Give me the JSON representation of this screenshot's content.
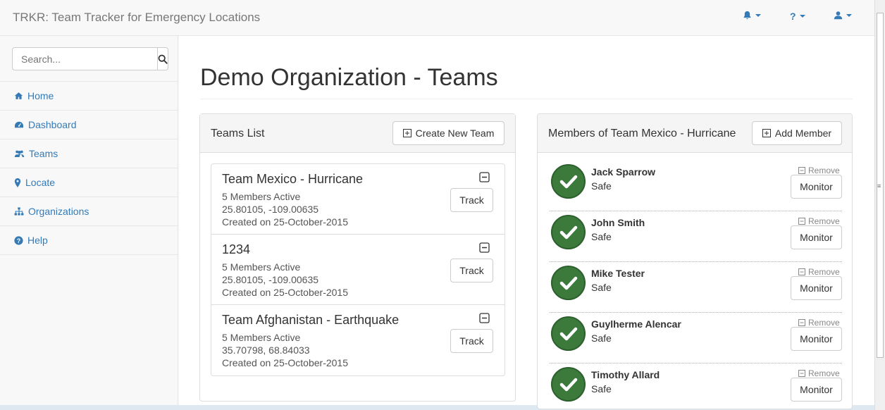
{
  "app": {
    "title": "TRKR: Team Tracker for Emergency Locations"
  },
  "navbar": {
    "items": [
      "bell-icon",
      "question-icon",
      "user-icon"
    ]
  },
  "sidebar": {
    "search_placeholder": "Search...",
    "items": [
      {
        "label": "Home",
        "icon": "home-icon"
      },
      {
        "label": "Dashboard",
        "icon": "dashboard-icon"
      },
      {
        "label": "Teams",
        "icon": "users-icon"
      },
      {
        "label": "Locate",
        "icon": "map-marker-icon"
      },
      {
        "label": "Organizations",
        "icon": "sitemap-icon"
      },
      {
        "label": "Help",
        "icon": "help-icon"
      }
    ]
  },
  "main": {
    "page_title": "Demo Organization - Teams",
    "teams_panel": {
      "title": "Teams List",
      "create_label": "Create New Team",
      "teams": [
        {
          "name": "Team Mexico - Hurricane",
          "members": "5 Members Active",
          "coords": "25.80105, -109.00635",
          "created": "Created on 25-October-2015",
          "track_label": "Track"
        },
        {
          "name": "1234",
          "members": "5 Members Active",
          "coords": "25.80105, -109.00635",
          "created": "Created on 25-October-2015",
          "track_label": "Track"
        },
        {
          "name": "Team Afghanistan - Earthquake",
          "members": "5 Members Active",
          "coords": "35.70798, 68.84033",
          "created": "Created on 25-October-2015",
          "track_label": "Track"
        }
      ]
    },
    "members_panel": {
      "title": "Members of Team Mexico - Hurricane",
      "add_label": "Add Member",
      "members": [
        {
          "name": "Jack Sparrow",
          "status": "Safe",
          "remove_label": "Remove",
          "monitor_label": "Monitor"
        },
        {
          "name": "John Smith",
          "status": "Safe",
          "remove_label": "Remove",
          "monitor_label": "Monitor"
        },
        {
          "name": "Mike Tester",
          "status": "Safe",
          "remove_label": "Remove",
          "monitor_label": "Monitor"
        },
        {
          "name": "Guylherme Alencar",
          "status": "Safe",
          "remove_label": "Remove",
          "monitor_label": "Monitor"
        },
        {
          "name": "Timothy Allard",
          "status": "Safe",
          "remove_label": "Remove",
          "monitor_label": "Monitor"
        }
      ]
    }
  },
  "colors": {
    "link": "#337ab7",
    "safe": "#3c7a3c",
    "navbar_bg": "#f8f8f8"
  }
}
